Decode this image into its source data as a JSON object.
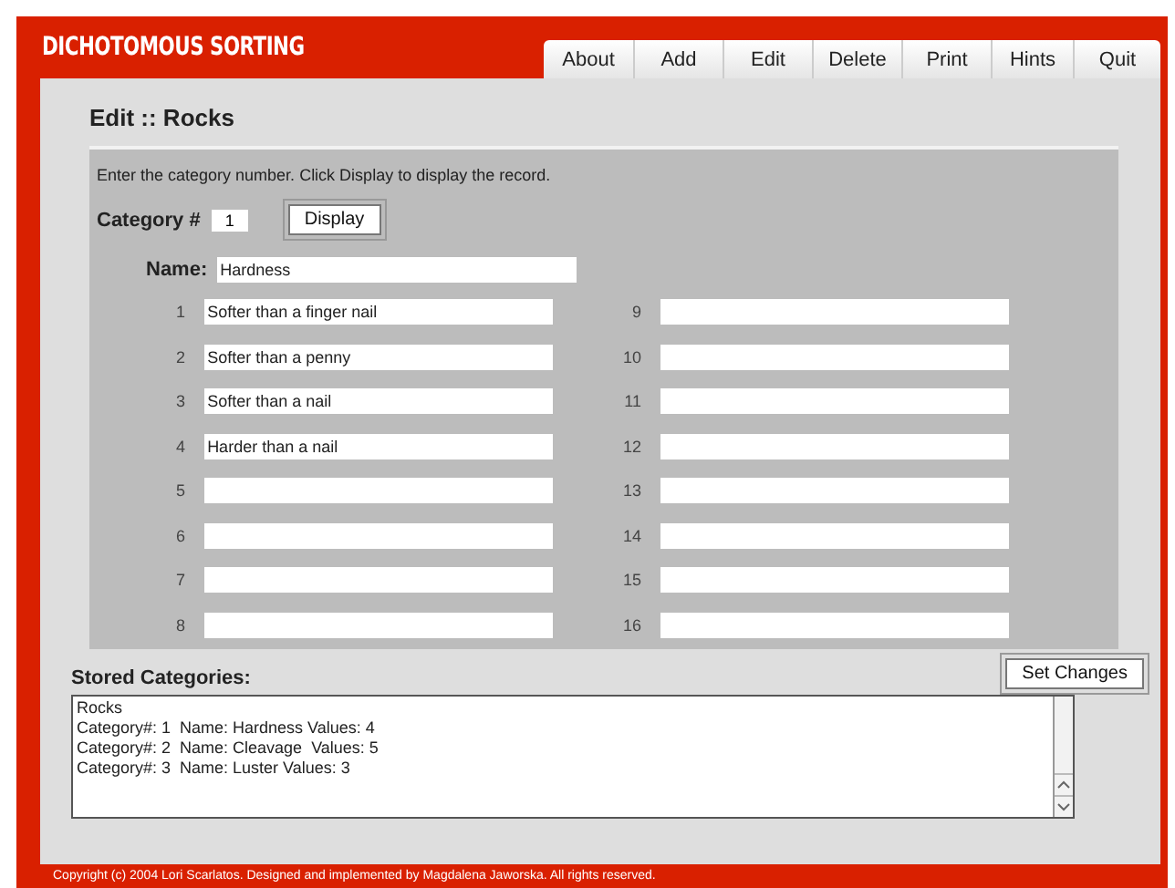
{
  "app_title": "DICHOTOMOUS SORTING",
  "menu": [
    "About",
    "Add",
    "Edit",
    "Delete",
    "Print",
    "Hints",
    "Quit"
  ],
  "page_title": "Edit :: Rocks",
  "instructions": "Enter the category number. Click Display to display the record.",
  "category": {
    "label": "Category #",
    "value": "1",
    "button": "Display"
  },
  "name": {
    "label": "Name:",
    "value": "Hardness"
  },
  "values": [
    {
      "number": "1",
      "value": "Softer than a finger nail"
    },
    {
      "number": "2",
      "value": "Softer than a penny"
    },
    {
      "number": "3",
      "value": "Softer than a nail"
    },
    {
      "number": "4",
      "value": "Harder than a nail"
    },
    {
      "number": "5"
    },
    {
      "number": "6"
    },
    {
      "number": "7"
    },
    {
      "number": "8"
    },
    {
      "number": "9"
    },
    {
      "number": "10"
    },
    {
      "number": "11"
    },
    {
      "number": "12"
    },
    {
      "number": "13"
    },
    {
      "number": "14"
    },
    {
      "number": "15"
    },
    {
      "number": "16"
    }
  ],
  "set_changes_button": "Set Changes",
  "stored": {
    "label": "Stored Categories:",
    "lines": [
      "Rocks",
      "Category#: 1  Name: Hardness Values: 4",
      "Category#: 2  Name: Cleavage  Values: 5",
      "Category#: 3  Name: Luster Values: 3"
    ]
  },
  "footer": "Copyright  (c) 2004 Lori Scarlatos. Designed and implemented by Magdalena Jaworska. All rights reserved."
}
